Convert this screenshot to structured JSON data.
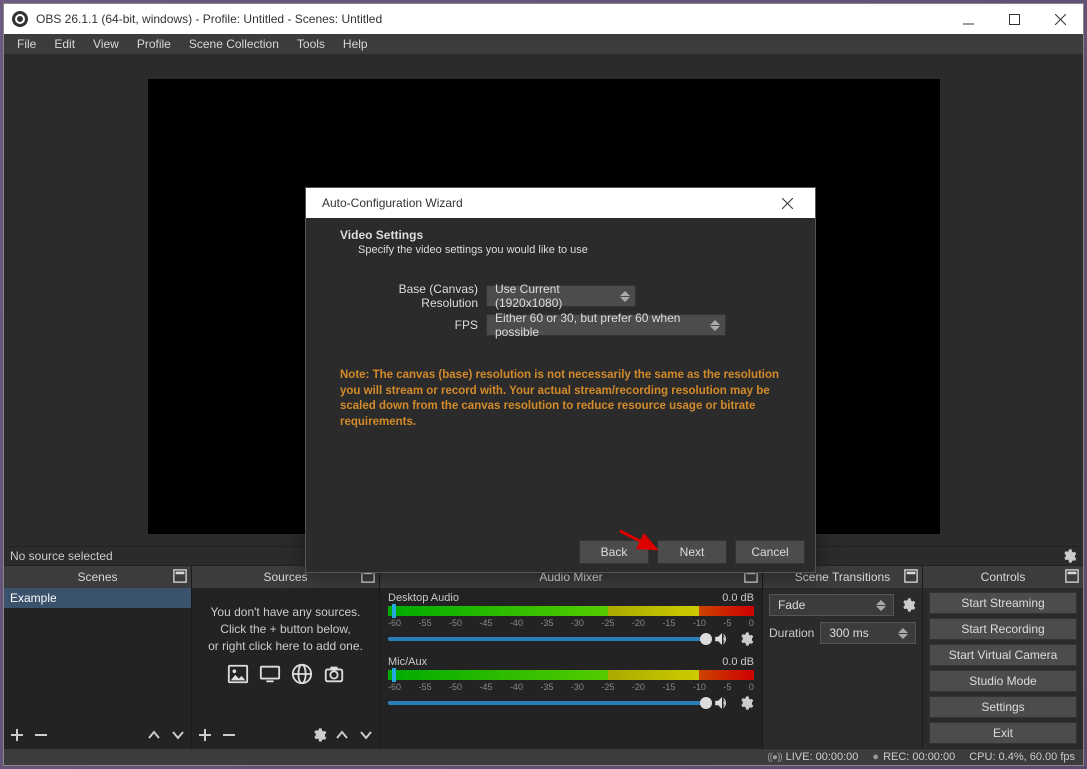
{
  "title": "OBS 26.1.1 (64-bit, windows) - Profile: Untitled - Scenes: Untitled",
  "menubar": [
    "File",
    "Edit",
    "View",
    "Profile",
    "Scene Collection",
    "Tools",
    "Help"
  ],
  "src_toolbar": {
    "text": "No source selected"
  },
  "panels": {
    "scenes": {
      "title": "Scenes",
      "item": "Example"
    },
    "sources": {
      "title": "Sources",
      "msg1": "You don't have any sources.",
      "msg2": "Click the + button below,",
      "msg3": "or right click here to add one."
    },
    "mixer": {
      "title": "Audio Mixer",
      "tracks": [
        {
          "name": "Desktop Audio",
          "db": "0.0 dB"
        },
        {
          "name": "Mic/Aux",
          "db": "0.0 dB"
        }
      ],
      "scale": [
        "-60",
        "-55",
        "-50",
        "-45",
        "-40",
        "-35",
        "-30",
        "-25",
        "-20",
        "-15",
        "-10",
        "-5",
        "0"
      ]
    },
    "transitions": {
      "title": "Scene Transitions",
      "type": "Fade",
      "duration_label": "Duration",
      "duration_value": "300 ms"
    },
    "controls": {
      "title": "Controls",
      "buttons": [
        "Start Streaming",
        "Start Recording",
        "Start Virtual Camera",
        "Studio Mode",
        "Settings",
        "Exit"
      ]
    }
  },
  "status": {
    "live": "LIVE: 00:00:00",
    "rec": "REC: 00:00:00",
    "cpu": "CPU: 0.4%, 60.00 fps"
  },
  "dialog": {
    "title": "Auto-Configuration Wizard",
    "heading": "Video Settings",
    "sub": "Specify the video settings you would like to use",
    "res_label": "Base (Canvas) Resolution",
    "res_value": "Use Current (1920x1080)",
    "fps_label": "FPS",
    "fps_value": "Either 60 or 30, but prefer 60 when possible",
    "note": "Note: The canvas (base) resolution is not necessarily the same as the resolution you will stream or record with. Your actual stream/recording resolution may be scaled down from the canvas resolution to reduce resource usage or bitrate requirements.",
    "back": "Back",
    "next": "Next",
    "cancel": "Cancel"
  }
}
